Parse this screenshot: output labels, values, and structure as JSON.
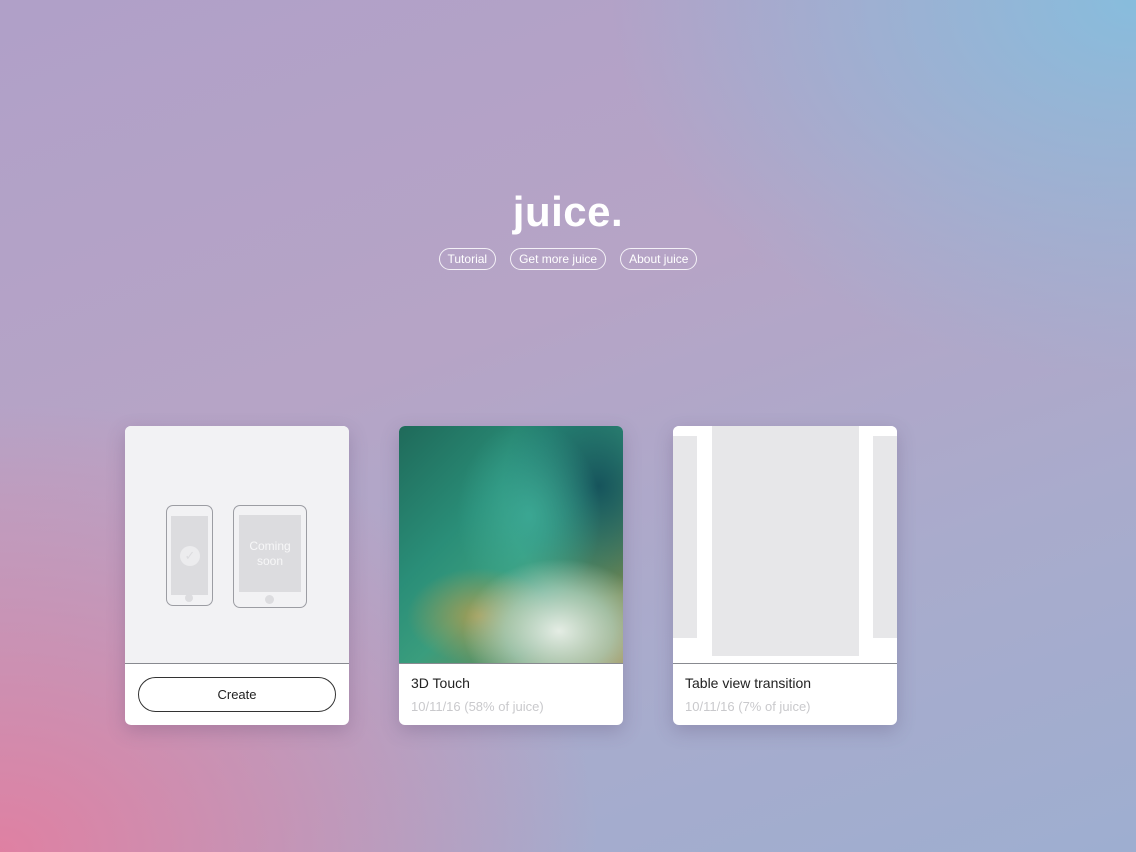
{
  "app": {
    "title": "juice."
  },
  "nav": {
    "tutorial": "Tutorial",
    "get_more": "Get more juice",
    "about": "About juice"
  },
  "cards": [
    {
      "type": "create",
      "tablet_label": "Coming soon",
      "button_label": "Create"
    },
    {
      "type": "project",
      "title": "3D Touch",
      "meta": "10/11/16 (58% of juice)"
    },
    {
      "type": "project",
      "title": "Table view transition",
      "meta": "10/11/16 (7% of juice)"
    }
  ],
  "icons": {
    "check": "checkmark-icon",
    "phone": "iphone-icon",
    "tablet": "ipad-icon"
  },
  "colors": {
    "accent_white": "#ffffff",
    "card_bg": "#ffffff",
    "meta_text": "#c9c9cc",
    "placeholder": "#e7e7e9"
  }
}
